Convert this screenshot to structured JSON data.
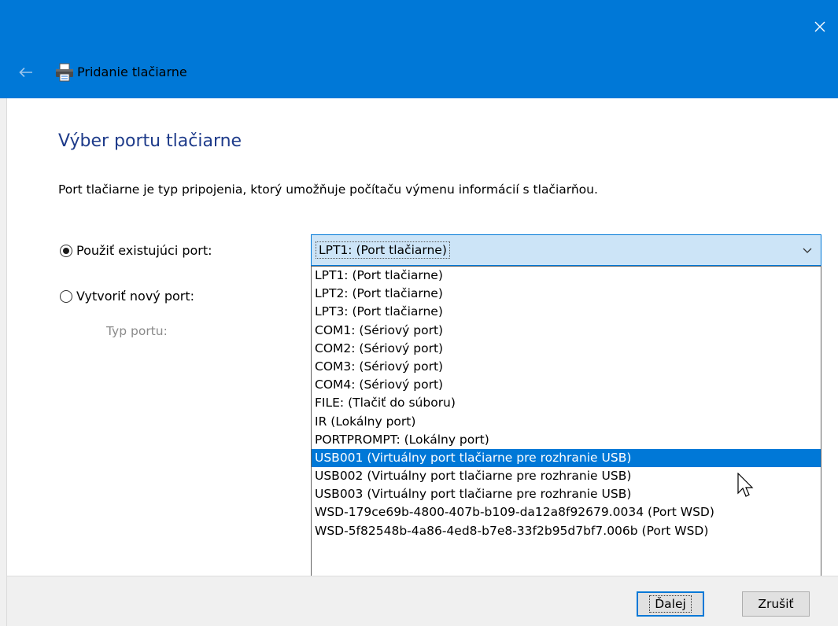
{
  "window": {
    "title": "Pridanie tlačiarne",
    "close_icon": "close-icon",
    "back_icon": "back-arrow-icon",
    "printer_icon": "printer-icon",
    "accent_color": "#0078d7"
  },
  "page": {
    "heading": "Výber portu tlačiarne",
    "description": "Port tlačiarne je typ pripojenia, ktorý umožňuje počítaču výmenu informácií s tlačiarňou."
  },
  "options": {
    "use_existing_label": "Použiť existujúci port:",
    "use_existing_checked": true,
    "create_new_label": "Vytvoriť nový port:",
    "create_new_checked": false,
    "port_type_label": "Typ portu:"
  },
  "port_select": {
    "selected_value": "LPT1: (Port tlačiarne)",
    "highlighted_index": 10,
    "items": [
      "LPT1: (Port tlačiarne)",
      "LPT2: (Port tlačiarne)",
      "LPT3: (Port tlačiarne)",
      "COM1: (Sériový port)",
      "COM2: (Sériový port)",
      "COM3: (Sériový port)",
      "COM4: (Sériový port)",
      "FILE: (Tlačiť do súboru)",
      "IR (Lokálny port)",
      "PORTPROMPT: (Lokálny port)",
      "USB001 (Virtuálny port tlačiarne pre rozhranie USB)",
      "USB002 (Virtuálny port tlačiarne pre rozhranie USB)",
      "USB003 (Virtuálny port tlačiarne pre rozhranie USB)",
      "WSD-179ce69b-4800-407b-b109-da12a8f92679.0034 (Port WSD)",
      "WSD-5f82548b-4a86-4ed8-b7e8-33f2b95d7bf7.006b (Port WSD)"
    ]
  },
  "buttons": {
    "next_label": "Ďalej",
    "cancel_label": "Zrušiť"
  }
}
